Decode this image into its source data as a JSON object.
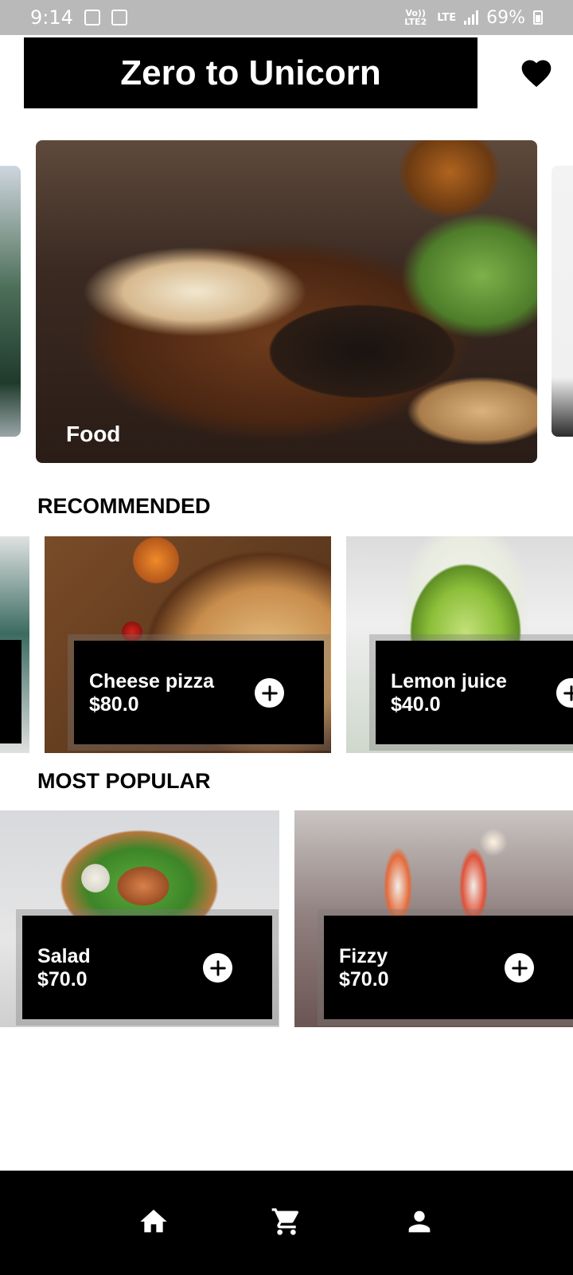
{
  "status_bar": {
    "time": "9:14",
    "network_top": "Vo)) LTE2",
    "network_label": "LTE",
    "battery": "69%"
  },
  "header": {
    "title": "Zero to Unicorn",
    "favorite_icon": "heart-icon"
  },
  "banner": {
    "label": "Food"
  },
  "sections": {
    "recommended_title": "RECOMMENDED",
    "popular_title": "MOST POPULAR"
  },
  "recommended": [
    {
      "name": "Cheese pizza",
      "price": "$80.0"
    },
    {
      "name": "Lemon juice",
      "price": "$40.0"
    }
  ],
  "popular": [
    {
      "name": "Salad",
      "price": "$70.0"
    },
    {
      "name": "Fizzy",
      "price": "$70.0"
    }
  ],
  "bottom_nav": {
    "items": [
      "home-icon",
      "cart-icon",
      "profile-icon"
    ]
  },
  "colors": {
    "header_bg": "#000000",
    "status_bar_bg": "#b9b9b9",
    "panel_bg": "#000000",
    "nav_bg": "#000000"
  }
}
